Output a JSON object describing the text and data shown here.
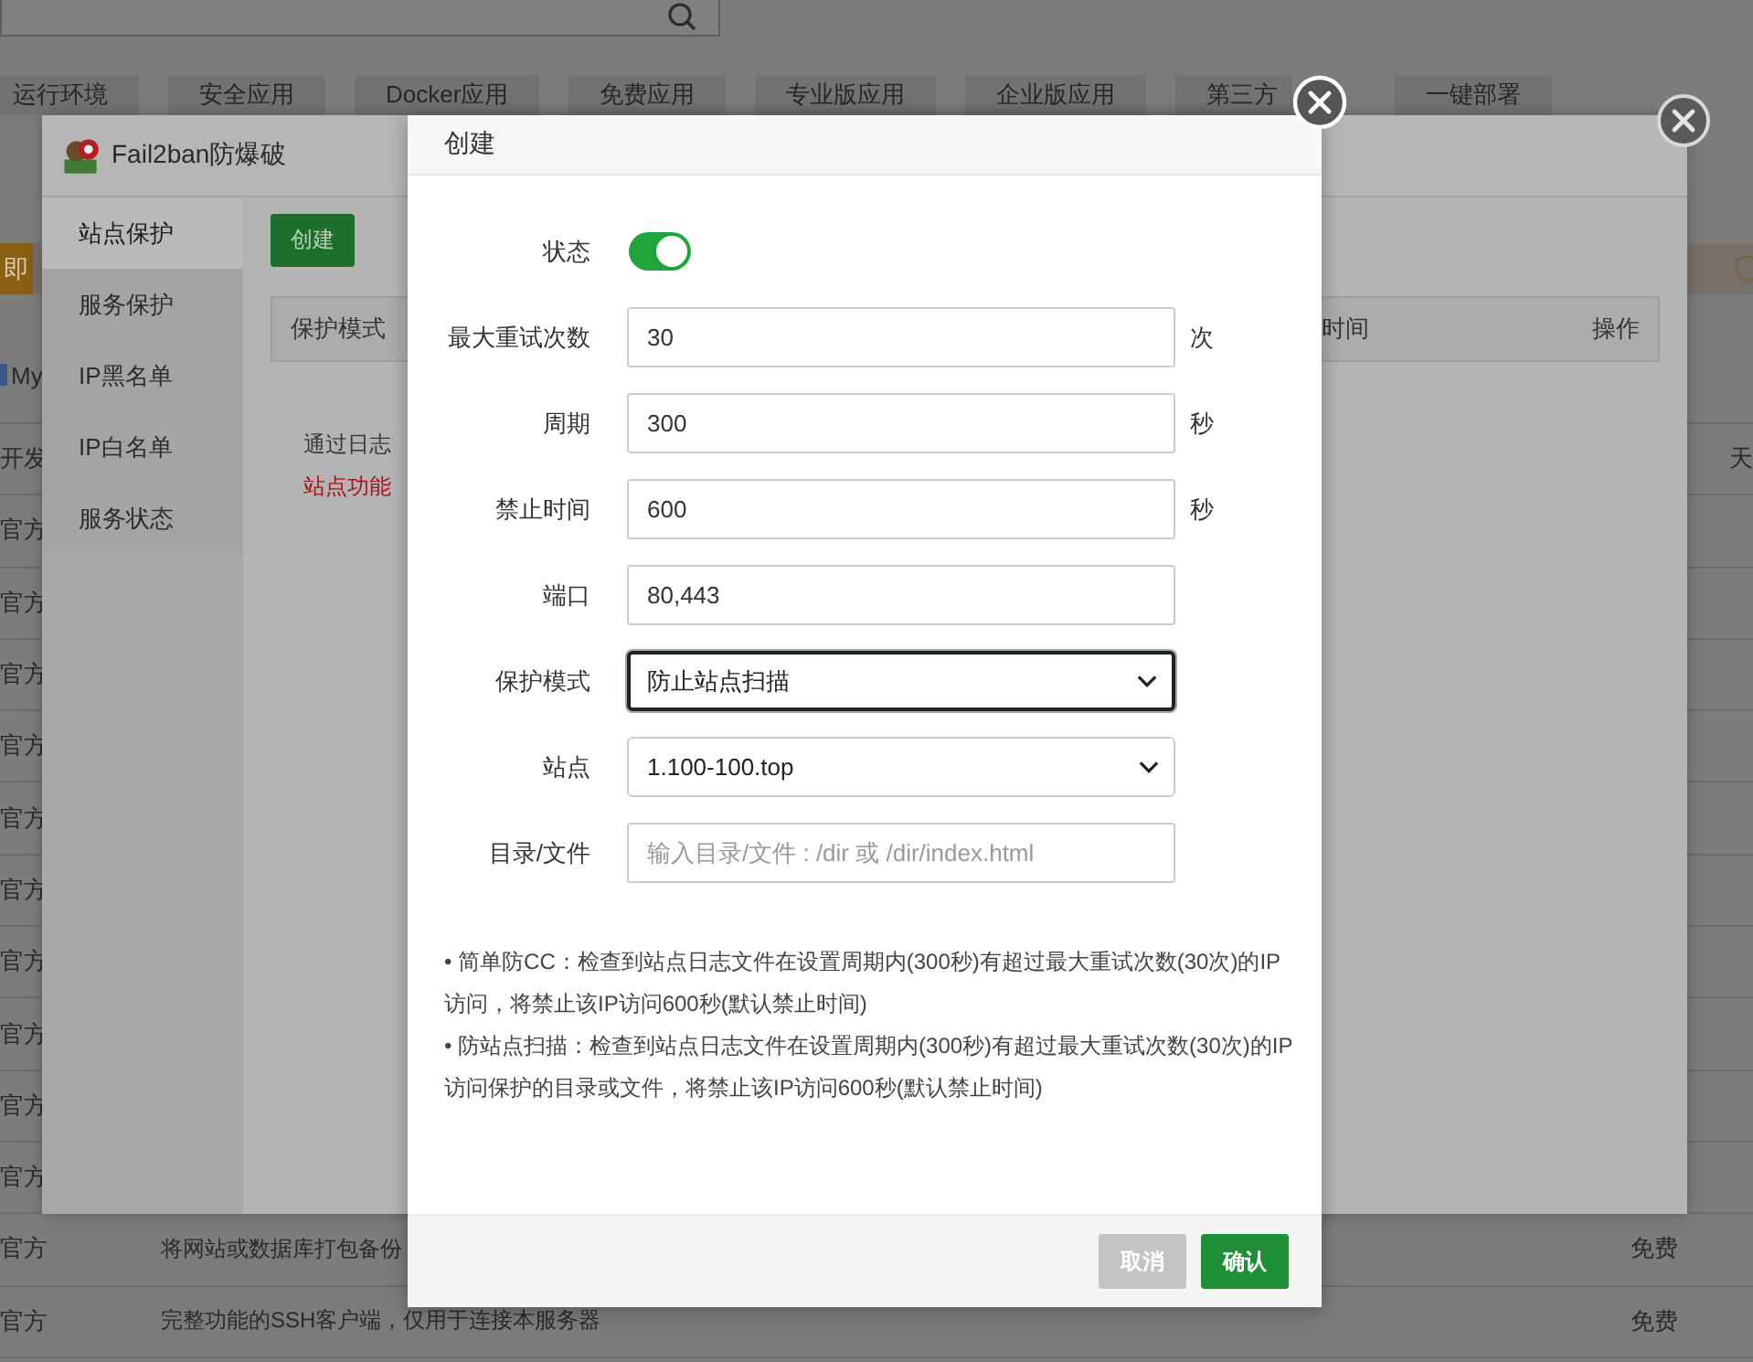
{
  "background_page": {
    "tabs": [
      "运行环境",
      "安全应用",
      "Docker应用",
      "免费应用",
      "专业版应用",
      "企业版应用",
      "第三方",
      "一键部署"
    ],
    "promo_button": "即",
    "top_row": "My",
    "rows": [
      {
        "column_1": "开发",
        "column_3": "天"
      },
      {
        "column_1": "官方"
      },
      {
        "column_1": "官方"
      },
      {
        "column_1": "官方"
      },
      {
        "column_1": "官方"
      },
      {
        "column_1": "官方"
      },
      {
        "column_1": "官方"
      },
      {
        "column_1": "官方"
      },
      {
        "column_1": "官方"
      },
      {
        "column_1": "官方"
      },
      {
        "column_1": "官方"
      },
      {
        "column_1": "官方",
        "column_2": "将网站或数据库打包备份",
        "column_3": "免费"
      },
      {
        "column_1": "官方",
        "column_2": "完整功能的SSH客户端，仅用于连接本服务器",
        "column_3": "免费"
      }
    ]
  },
  "plugin_window": {
    "title": "Fail2ban防爆破",
    "sidebar": [
      {
        "label": "站点保护",
        "selected": true
      },
      {
        "label": "服务保护",
        "selected": false
      },
      {
        "label": "IP黑名单",
        "selected": false
      },
      {
        "label": "IP白名单",
        "selected": false
      },
      {
        "label": "服务状态",
        "selected": false
      }
    ],
    "create_button": "创建",
    "table": {
      "columns": [
        "保护模式",
        "时间",
        "操作"
      ]
    },
    "notes": [
      {
        "text": "通过日志",
        "kind": "normal"
      },
      {
        "text": "站点功能",
        "kind": "warning"
      }
    ]
  },
  "dialog": {
    "title": "创建",
    "fields": [
      {
        "kind": "toggle",
        "label": "状态",
        "on": true
      },
      {
        "kind": "input",
        "label": "最大重试次数",
        "value": "30",
        "unit": "次"
      },
      {
        "kind": "input",
        "label": "周期",
        "value": "300",
        "unit": "秒"
      },
      {
        "kind": "input",
        "label": "禁止时间",
        "value": "600",
        "unit": "秒"
      },
      {
        "kind": "input",
        "label": "端口",
        "value": "80,443"
      },
      {
        "kind": "select",
        "label": "保护模式",
        "value": "防止站点扫描",
        "focused": true
      },
      {
        "kind": "select",
        "label": "站点",
        "value": "1.100-100.top",
        "focused": false
      },
      {
        "kind": "input",
        "label": "目录/文件",
        "placeholder": "输入目录/文件 : /dir 或 /dir/index.html"
      }
    ],
    "notes": [
      "• 简单防CC：检查到站点日志文件在设置周期内(300秒)有超过最大重试次数(30次)的IP访问，将禁止该IP访问600秒(默认禁止时间)",
      "• 防站点扫描：检查到站点日志文件在设置周期内(300秒)有超过最大重试次数(30次)的IP访问保护的目录或文件，将禁止该IP访问600秒(默认禁止时间)"
    ],
    "buttons": [
      {
        "label": "取消",
        "kind": "cancel"
      },
      {
        "label": "确认",
        "kind": "primary"
      }
    ]
  }
}
